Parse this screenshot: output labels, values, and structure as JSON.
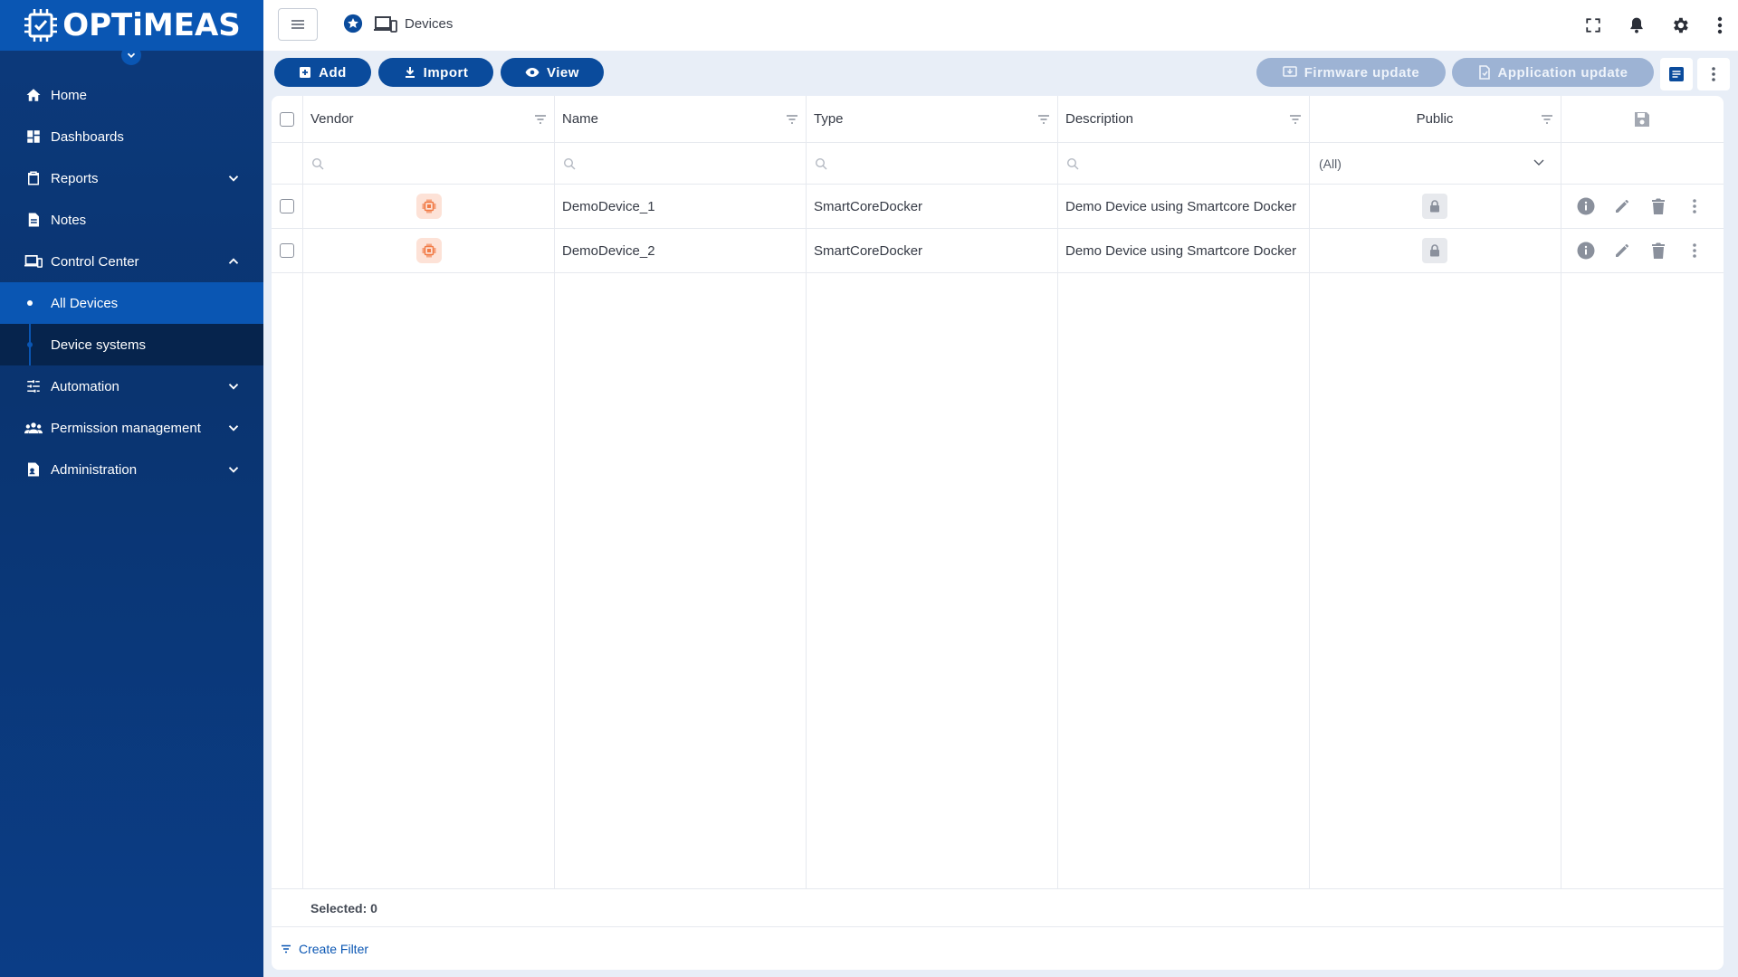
{
  "brand": {
    "logo_text": "OPTiMEAS"
  },
  "sidebar": {
    "items": [
      {
        "label": "Home",
        "icon": "home-icon"
      },
      {
        "label": "Dashboards",
        "icon": "dashboard-icon"
      },
      {
        "label": "Reports",
        "icon": "clipboard-icon"
      },
      {
        "label": "Notes",
        "icon": "note-icon"
      },
      {
        "label": "Control Center",
        "icon": "devices-icon"
      },
      {
        "label": "All Devices"
      },
      {
        "label": "Device systems"
      },
      {
        "label": "Automation",
        "icon": "sliders-icon"
      },
      {
        "label": "Permission management",
        "icon": "group-icon"
      },
      {
        "label": "Administration",
        "icon": "admin-icon"
      }
    ]
  },
  "header": {
    "breadcrumb": "Devices"
  },
  "toolbar": {
    "add": "Add",
    "import": "Import",
    "view": "View",
    "firmware_update": "Firmware update",
    "application_update": "Application update"
  },
  "grid": {
    "columns": [
      "Vendor",
      "Name",
      "Type",
      "Description",
      "Public"
    ],
    "public_filter_value": "(All)",
    "rows": [
      {
        "name": "DemoDevice_1",
        "type": "SmartCoreDocker",
        "description": "Demo Device using Smartcore Docker"
      },
      {
        "name": "DemoDevice_2",
        "type": "SmartCoreDocker",
        "description": "Demo Device using Smartcore Docker"
      }
    ],
    "selected_label": "Selected: 0",
    "create_filter": "Create Filter"
  },
  "colors": {
    "brand_blue": "#0a56b3",
    "button_blue": "#0a4b9c",
    "sidebar": "#0c3a7c"
  }
}
